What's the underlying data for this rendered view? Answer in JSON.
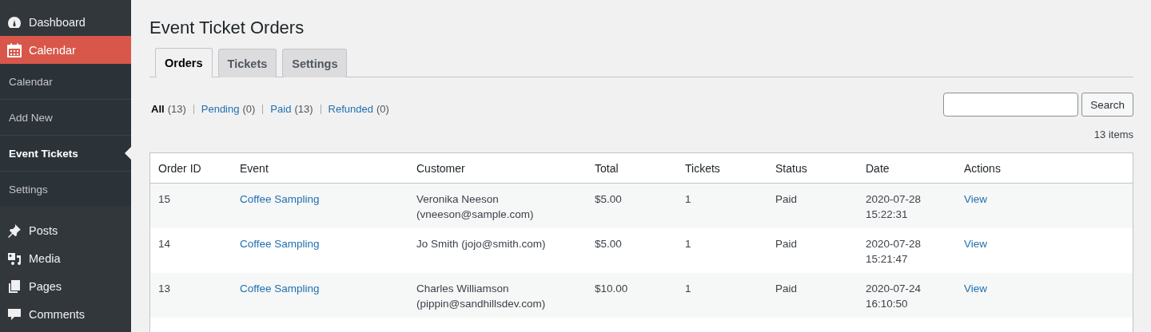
{
  "sidebar": {
    "items": [
      {
        "label": "Dashboard",
        "selected": false
      },
      {
        "label": "Calendar",
        "selected": true,
        "children": [
          {
            "label": "Calendar",
            "selected": false
          },
          {
            "label": "Add New",
            "selected": false
          },
          {
            "label": "Event Tickets",
            "selected": true
          },
          {
            "label": "Settings",
            "selected": false
          }
        ]
      },
      {
        "label": "Posts",
        "selected": false
      },
      {
        "label": "Media",
        "selected": false
      },
      {
        "label": "Pages",
        "selected": false
      },
      {
        "label": "Comments",
        "selected": false
      }
    ]
  },
  "page_title": "Event Ticket Orders",
  "tabs": [
    {
      "label": "Orders",
      "selected": true
    },
    {
      "label": "Tickets",
      "selected": false
    },
    {
      "label": "Settings",
      "selected": false
    }
  ],
  "filters": [
    {
      "label": "All",
      "count": "(13)",
      "selected": true
    },
    {
      "label": "Pending",
      "count": "(0)",
      "selected": false
    },
    {
      "label": "Paid",
      "count": "(13)",
      "selected": false
    },
    {
      "label": "Refunded",
      "count": "(0)",
      "selected": false
    }
  ],
  "search": {
    "button": "Search"
  },
  "item_count": "13 items",
  "table": {
    "columns": [
      "Order ID",
      "Event",
      "Customer",
      "Total",
      "Tickets",
      "Status",
      "Date",
      "Actions"
    ],
    "rows": [
      {
        "order_id": "15",
        "event": "Coffee Sampling",
        "customer": [
          "Veronika Neeson",
          "(vneeson@sample.com)"
        ],
        "total": "$5.00",
        "tickets": "1",
        "status": "Paid",
        "date": [
          "2020-07-28",
          "15:22:31"
        ],
        "action": "View"
      },
      {
        "order_id": "14",
        "event": "Coffee Sampling",
        "customer": [
          "Jo Smith (jojo@smith.com)"
        ],
        "total": "$5.00",
        "tickets": "1",
        "status": "Paid",
        "date": [
          "2020-07-28",
          "15:21:47"
        ],
        "action": "View"
      },
      {
        "order_id": "13",
        "event": "Coffee Sampling",
        "customer": [
          "Charles Williamson",
          "(pippin@sandhillsdev.com)"
        ],
        "total": "$10.00",
        "tickets": "1",
        "status": "Paid",
        "date": [
          "2020-07-24",
          "16:10:50"
        ],
        "action": "View"
      }
    ]
  }
}
